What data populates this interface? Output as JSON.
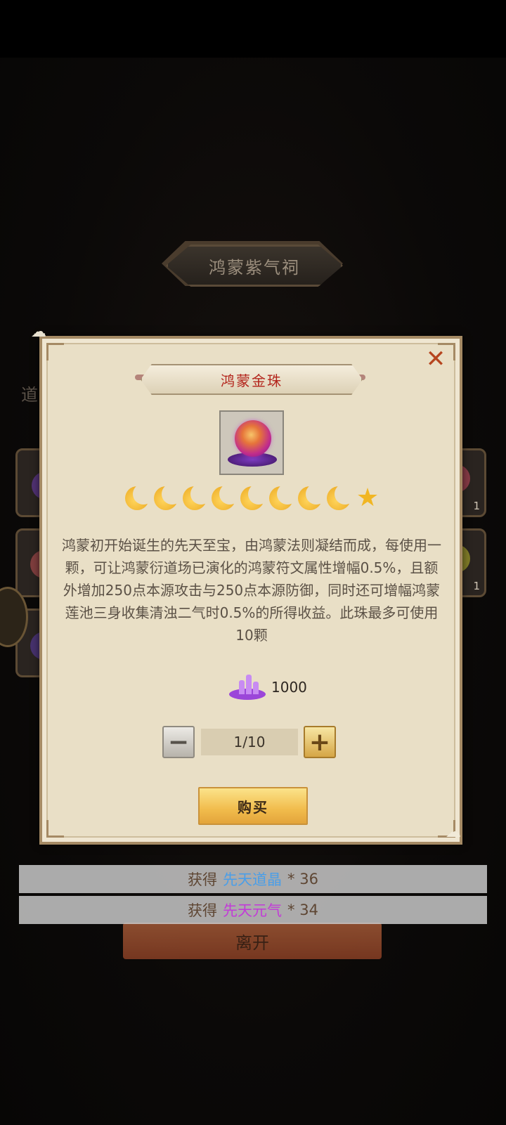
{
  "background": {
    "shrine_title": "鸿蒙紫气祠",
    "side_label": "道",
    "slot_counts": [
      "1",
      "1"
    ],
    "exit_label": "离开"
  },
  "dialog": {
    "item_name": "鸿蒙金珠",
    "star_rating": {
      "moons": 8,
      "stars": 1
    },
    "description": "鸿蒙初开始诞生的先天至宝，由鸿蒙法则凝结而成，每使用一颗，可让鸿蒙衍道场已演化的鸿蒙符文属性增幅0.5%，且额外增加250点本源攻击与250点本源防御，同时还可增幅鸿蒙莲池三身收集清浊二气时0.5%的所得收益。此珠最多可使用10颗",
    "price": "1000",
    "price_icon": "purple-crystal-icon",
    "quantity": "1/10",
    "buy_label": "购买",
    "close_icon": "close-x-icon"
  },
  "toasts": [
    {
      "prefix": "获得",
      "item": "先天道晶",
      "suffix": "* 36",
      "item_color": "#4a9ee8"
    },
    {
      "prefix": "获得",
      "item": "先天元气",
      "suffix": "* 34",
      "item_color": "#c23ad8"
    }
  ]
}
